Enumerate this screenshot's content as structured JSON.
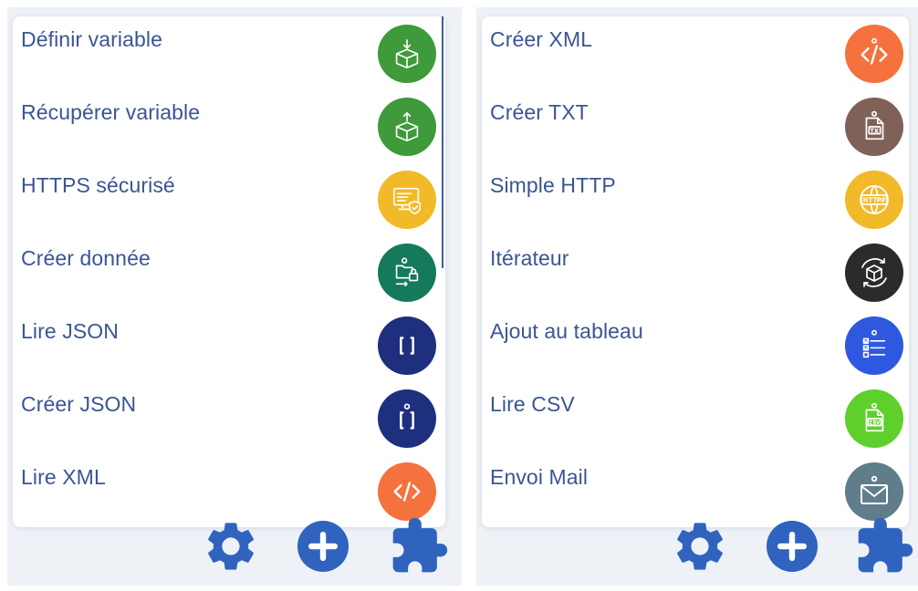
{
  "colors": {
    "label": "#3b5594",
    "toolbar": "#2f63be",
    "panel_bg": "#eef1f6"
  },
  "left_list": {
    "items": [
      {
        "label": "Définir variable",
        "icon": "box-down-icon",
        "color": "#3e9a3a"
      },
      {
        "label": "Récupérer variable",
        "icon": "box-up-icon",
        "color": "#3e9a3a"
      },
      {
        "label": "HTTPS sécurisé",
        "icon": "secure-monitor-icon",
        "color": "#f2b928"
      },
      {
        "label": "Créer donnée",
        "icon": "folder-lock-icon",
        "color": "#157a5b"
      },
      {
        "label": "Lire JSON",
        "icon": "json-braces-icon",
        "color": "#1e2f7e"
      },
      {
        "label": "Créer JSON",
        "icon": "json-create-icon",
        "color": "#1e2f7e"
      },
      {
        "label": "Lire XML",
        "icon": "xml-code-icon",
        "color": "#f5713d"
      }
    ]
  },
  "right_list": {
    "items": [
      {
        "label": "Créer XML",
        "icon": "xml-code-icon",
        "color": "#f5713d"
      },
      {
        "label": "Créer TXT",
        "icon": "txt-file-icon",
        "color": "#7f6158"
      },
      {
        "label": "Simple HTTP",
        "icon": "http-globe-icon",
        "color": "#f2b928"
      },
      {
        "label": "Itérateur",
        "icon": "iterator-cube-icon",
        "color": "#2b2b2b"
      },
      {
        "label": "Ajout au tableau",
        "icon": "checklist-icon",
        "color": "#2e58e0"
      },
      {
        "label": "Lire CSV",
        "icon": "csv-file-icon",
        "color": "#5fcf2c"
      },
      {
        "label": "Envoi Mail",
        "icon": "mail-icon",
        "color": "#607d8b"
      }
    ]
  },
  "toolbar": {
    "buttons": [
      {
        "name": "settings",
        "icon": "gear-icon"
      },
      {
        "name": "add",
        "icon": "plus-circle-icon"
      },
      {
        "name": "plugins",
        "icon": "puzzle-icon"
      }
    ]
  }
}
